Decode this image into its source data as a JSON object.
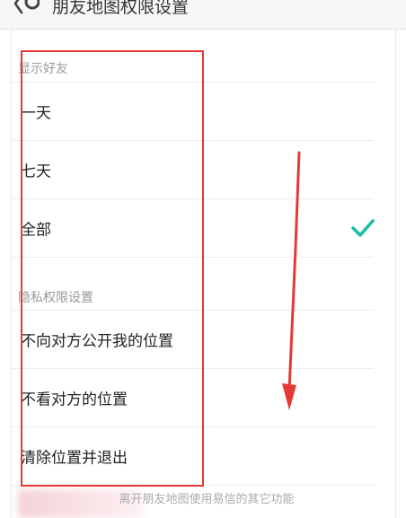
{
  "header": {
    "title": "朋友地图权限设置",
    "back_icon": "chevron-left-icon"
  },
  "sections": [
    {
      "header": "显示好友",
      "items": [
        {
          "label": "一天",
          "checked": false
        },
        {
          "label": "七天",
          "checked": false
        },
        {
          "label": "全部",
          "checked": true
        }
      ]
    },
    {
      "header": "隐私权限设置",
      "items": [
        {
          "label": "不向对方公开我的位置"
        },
        {
          "label": "不看对方的位置"
        },
        {
          "label": "清除位置并退出"
        }
      ]
    }
  ],
  "footer": {
    "hint": "离开朋友地图使用易信的其它功能"
  },
  "colors": {
    "check": "#1bbfa0",
    "annotation": "#e53935",
    "section_header": "#999999"
  }
}
